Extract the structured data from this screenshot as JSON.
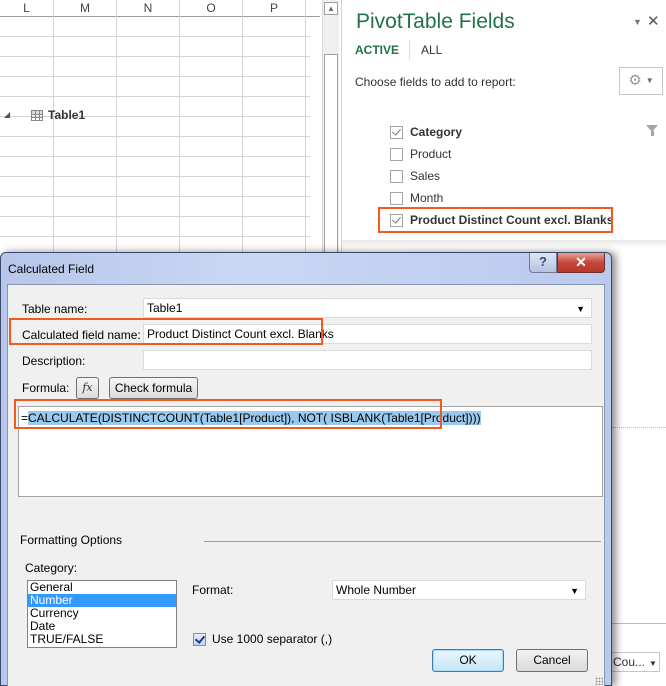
{
  "spreadsheet": {
    "columns": [
      "L",
      "M",
      "N",
      "O",
      "P"
    ]
  },
  "pivot_panel": {
    "title": "PivotTable Fields",
    "dropdown_icon": "caret-down-icon",
    "close_icon": "close-icon",
    "tabs": [
      {
        "label": "ACTIVE",
        "active": true
      },
      {
        "label": "ALL",
        "active": false
      }
    ],
    "choose_label": "Choose fields to add to report:",
    "settings_icon": "gear-icon",
    "table": {
      "name": "Table1",
      "fields": [
        {
          "label": "Category",
          "checked": true,
          "bold": true,
          "filtered": true
        },
        {
          "label": "Product",
          "checked": false,
          "bold": false
        },
        {
          "label": "Sales",
          "checked": false,
          "bold": false
        },
        {
          "label": "Month",
          "checked": false,
          "bold": false
        },
        {
          "label": "Product Distinct Count excl. Blanks",
          "checked": true,
          "bold": true,
          "highlighted": true
        }
      ]
    },
    "values_dropdown": "Cou..."
  },
  "dialog": {
    "title": "Calculated Field",
    "help_label": "?",
    "close_label": "✕",
    "table_name_label": "Table name:",
    "table_name_value": "Table1",
    "field_name_label": "Calculated field name:",
    "field_name_value": "Product Distinct Count excl. Blanks",
    "description_label": "Description:",
    "description_value": "",
    "formula_label": "Formula:",
    "fx_label": "fx",
    "check_formula_label": "Check formula",
    "formula_prefix": "=",
    "formula_selected": "CALCULATE(DISTINCTCOUNT(Table1[Product]), NOT( ISBLANK(Table1[Product])))",
    "formatting_heading": "Formatting Options",
    "category_label": "Category:",
    "categories": [
      "General",
      "Number",
      "Currency",
      "Date",
      "TRUE/FALSE"
    ],
    "selected_category": "Number",
    "format_label": "Format:",
    "format_value": "Whole Number",
    "separator_label": "Use 1000 separator (,)",
    "separator_checked": true,
    "ok_label": "OK",
    "cancel_label": "Cancel"
  },
  "colors": {
    "accent_green": "#217346",
    "highlight_orange": "#f15a22",
    "selection_blue": "#3399ff"
  }
}
